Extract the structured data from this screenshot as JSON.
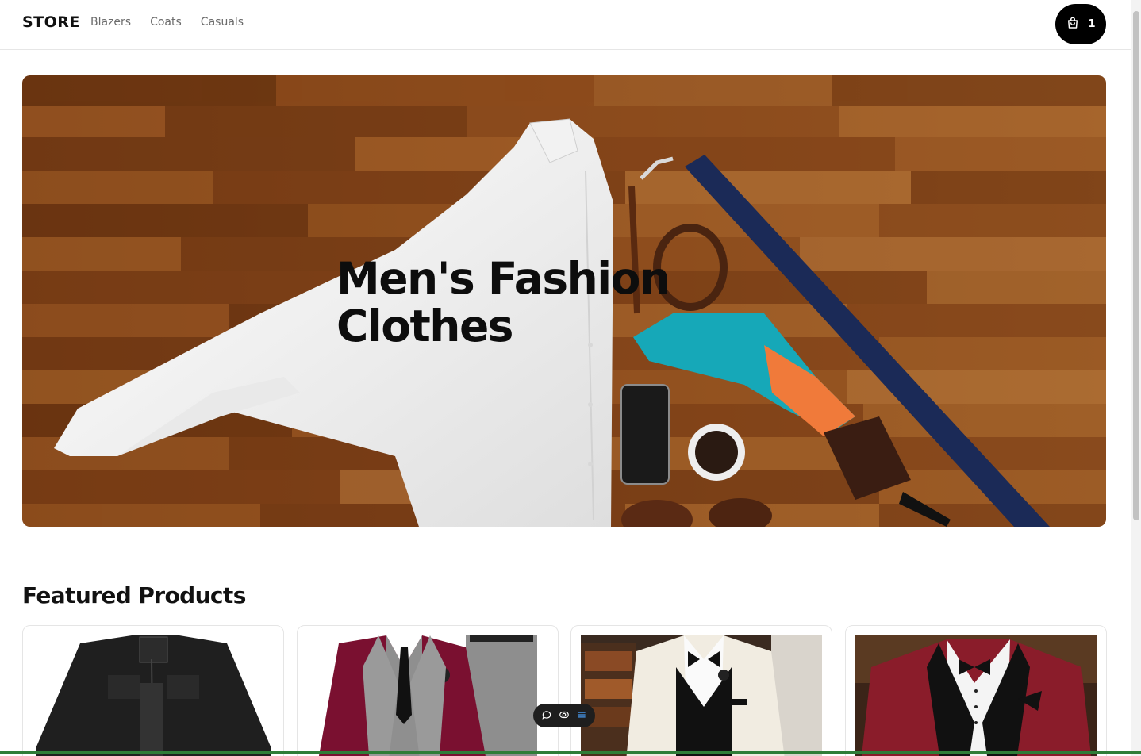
{
  "header": {
    "brand": "STORE",
    "nav": [
      "Blazers",
      "Coats",
      "Casuals"
    ],
    "cart": {
      "icon": "shopping-bag-icon",
      "count": "1"
    }
  },
  "hero": {
    "title_line1": "Men's Fashion",
    "title_line2": "Clothes"
  },
  "featured": {
    "title": "Featured Products",
    "products": [
      {
        "image": "black-jacket"
      },
      {
        "image": "burgundy-grey-suit"
      },
      {
        "image": "white-tuxedo"
      },
      {
        "image": "red-velvet-tuxedo"
      }
    ]
  },
  "toolbar": {
    "icons": [
      "comment-icon",
      "eye-icon",
      "menu-icon"
    ]
  },
  "colors": {
    "accent": "#000000",
    "wood": "#8a4a1c",
    "muted_text": "#6b6b6b"
  }
}
